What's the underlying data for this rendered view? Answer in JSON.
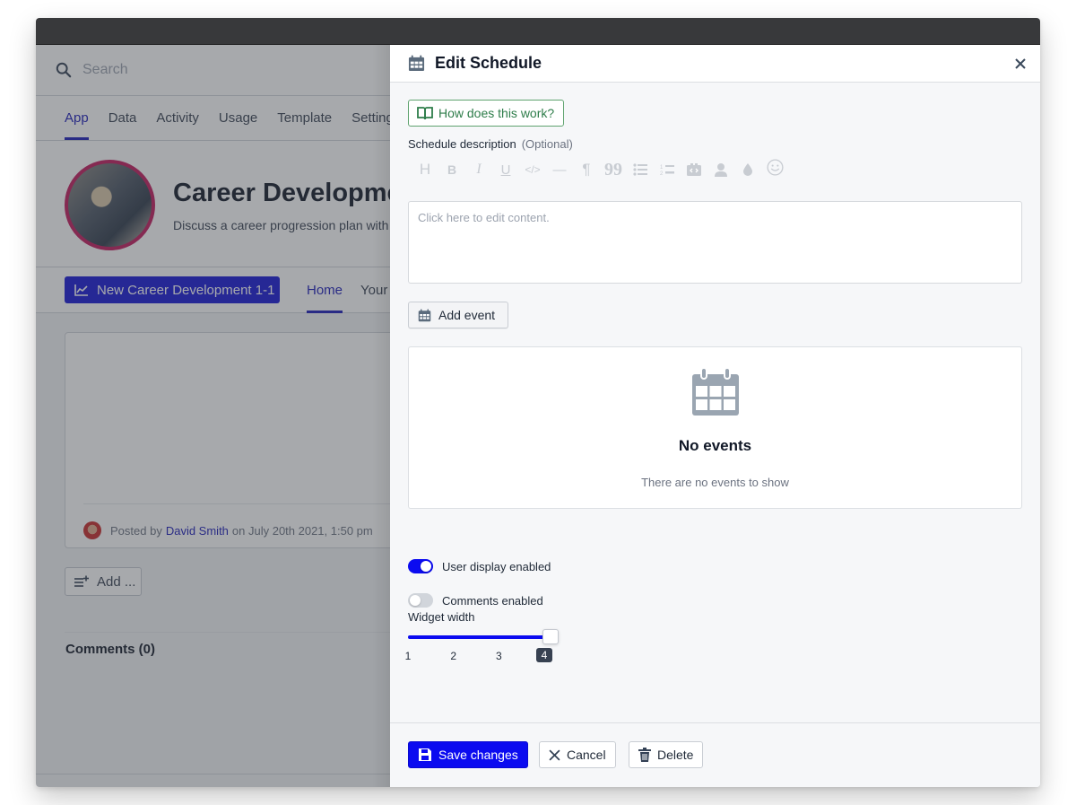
{
  "background": {
    "search": {
      "placeholder": "Search"
    },
    "nav_tabs": [
      {
        "label": "App",
        "active": true
      },
      {
        "label": "Data",
        "active": false
      },
      {
        "label": "Activity",
        "active": false
      },
      {
        "label": "Usage",
        "active": false
      },
      {
        "label": "Template",
        "active": false
      },
      {
        "label": "Settings",
        "active": false
      }
    ],
    "app": {
      "title": "Career Development",
      "subtitle": "Discuss a career progression plan with"
    },
    "new_button_label": "New Career Development 1-1",
    "sub_tabs": [
      {
        "label": "Home",
        "active": true
      },
      {
        "label": "Your",
        "active": false
      }
    ],
    "post": {
      "posted_by_prefix": "Posted by",
      "author": "David Smith",
      "posted_suffix": "on July 20th 2021, 1:50 pm"
    },
    "add_button_label": "Add ...",
    "comments_label": "Comments (0)"
  },
  "panel": {
    "title": "Edit Schedule",
    "icon": "calendar-icon",
    "help_button_label": "How does this work?",
    "description": {
      "label": "Schedule description",
      "optional": "(Optional)",
      "placeholder": "Click here to edit content."
    },
    "toolbar": [
      {
        "name": "heading-icon",
        "glyph": "H"
      },
      {
        "name": "bold-icon",
        "glyph": "B"
      },
      {
        "name": "italic-icon",
        "glyph": "I"
      },
      {
        "name": "underline-icon",
        "glyph": "U"
      },
      {
        "name": "code-icon",
        "glyph": "</>"
      },
      {
        "name": "horizontal-rule-icon",
        "glyph": "—"
      },
      {
        "name": "paragraph-icon",
        "glyph": "¶"
      },
      {
        "name": "quote-icon",
        "glyph": "❞"
      },
      {
        "name": "bullet-list-icon",
        "glyph": "☰"
      },
      {
        "name": "numbered-list-icon",
        "glyph": "≔"
      },
      {
        "name": "embed-icon",
        "glyph": "⧉"
      },
      {
        "name": "user-mention-icon",
        "glyph": "👤"
      },
      {
        "name": "color-icon",
        "glyph": "💧"
      },
      {
        "name": "emoji-icon",
        "glyph": "☺"
      }
    ],
    "add_event_label": "Add event",
    "empty_state": {
      "title": "No events",
      "message": "There are no events to show"
    },
    "toggles": [
      {
        "label": "User display enabled",
        "enabled": true
      },
      {
        "label": "Comments enabled",
        "enabled": false
      }
    ],
    "widget_width": {
      "label": "Widget width",
      "ticks": [
        "1",
        "2",
        "3",
        "4"
      ],
      "value": 4,
      "min": 1,
      "max": 4
    },
    "footer": {
      "save_label": "Save changes",
      "cancel_label": "Cancel",
      "delete_label": "Delete"
    }
  },
  "colors": {
    "primary": "#0b0bf0",
    "link": "#1a1ab8",
    "help_green": "#2e7d4a",
    "avatar_ring": "#c2185b"
  }
}
